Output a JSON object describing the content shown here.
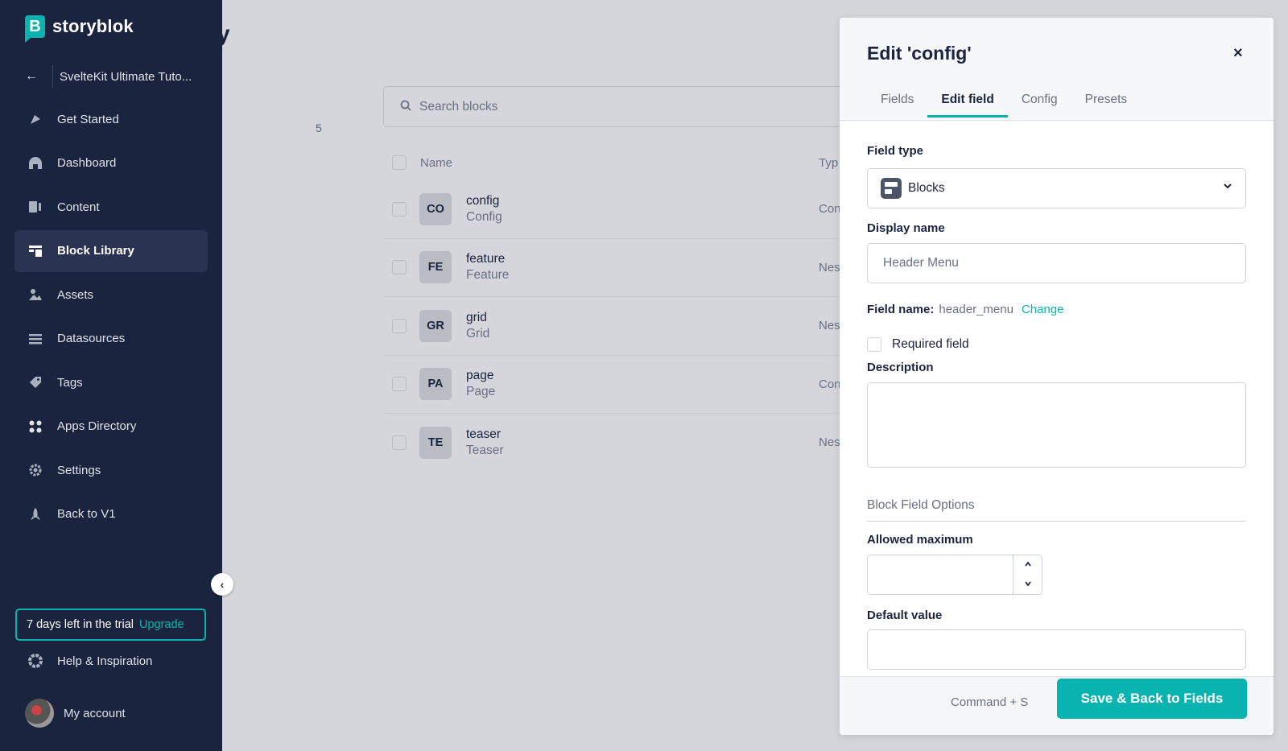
{
  "sidebar": {
    "logo_text": "storyblok",
    "logo_letter": "B",
    "space_name": "SvelteKit Ultimate Tuto...",
    "items": [
      {
        "label": "Get Started",
        "icon": "rocket-hand-icon"
      },
      {
        "label": "Dashboard",
        "icon": "dashboard-icon"
      },
      {
        "label": "Content",
        "icon": "content-icon"
      },
      {
        "label": "Block Library",
        "icon": "block-library-icon",
        "active": true
      },
      {
        "label": "Assets",
        "icon": "assets-icon"
      },
      {
        "label": "Datasources",
        "icon": "datasources-icon"
      },
      {
        "label": "Tags",
        "icon": "tags-icon"
      },
      {
        "label": "Apps Directory",
        "icon": "apps-icon"
      },
      {
        "label": "Settings",
        "icon": "gear-icon"
      },
      {
        "label": "Back to V1",
        "icon": "rocket-icon"
      }
    ],
    "trial_text": "7 days left in the trial",
    "upgrade_label": "Upgrade",
    "help_label": "Help & Inspiration",
    "account_label": "My account"
  },
  "main": {
    "title_stub": "y",
    "count": "5",
    "search_placeholder": "Search blocks",
    "columns": {
      "name": "Name",
      "type": "Typ"
    },
    "rows": [
      {
        "badge": "CO",
        "name": "config",
        "display": "Config",
        "type": "Con"
      },
      {
        "badge": "FE",
        "name": "feature",
        "display": "Feature",
        "type": "Nes"
      },
      {
        "badge": "GR",
        "name": "grid",
        "display": "Grid",
        "type": "Nes"
      },
      {
        "badge": "PA",
        "name": "page",
        "display": "Page",
        "type": "Con"
      },
      {
        "badge": "TE",
        "name": "teaser",
        "display": "Teaser",
        "type": "Nes"
      }
    ]
  },
  "modal": {
    "title": "Edit 'config'",
    "close": "×",
    "tabs": [
      "Fields",
      "Edit field",
      "Config",
      "Presets"
    ],
    "active_tab": "Edit field",
    "field_type_label": "Field type",
    "field_type_value": "Blocks",
    "display_name_label": "Display name",
    "display_name_placeholder": "Header Menu",
    "field_name_label": "Field name:",
    "field_name_value": "header_menu",
    "change_label": "Change",
    "required_label": "Required field",
    "description_label": "Description",
    "section_title": "Block Field Options",
    "allowed_max_label": "Allowed maximum",
    "default_value_label": "Default value",
    "shortcut_hint": "Command + S",
    "save_label": "Save & Back to Fields"
  },
  "colors": {
    "sidebar": "#1b243f",
    "accent": "#09b3af",
    "overlay": "#d4d6db"
  }
}
